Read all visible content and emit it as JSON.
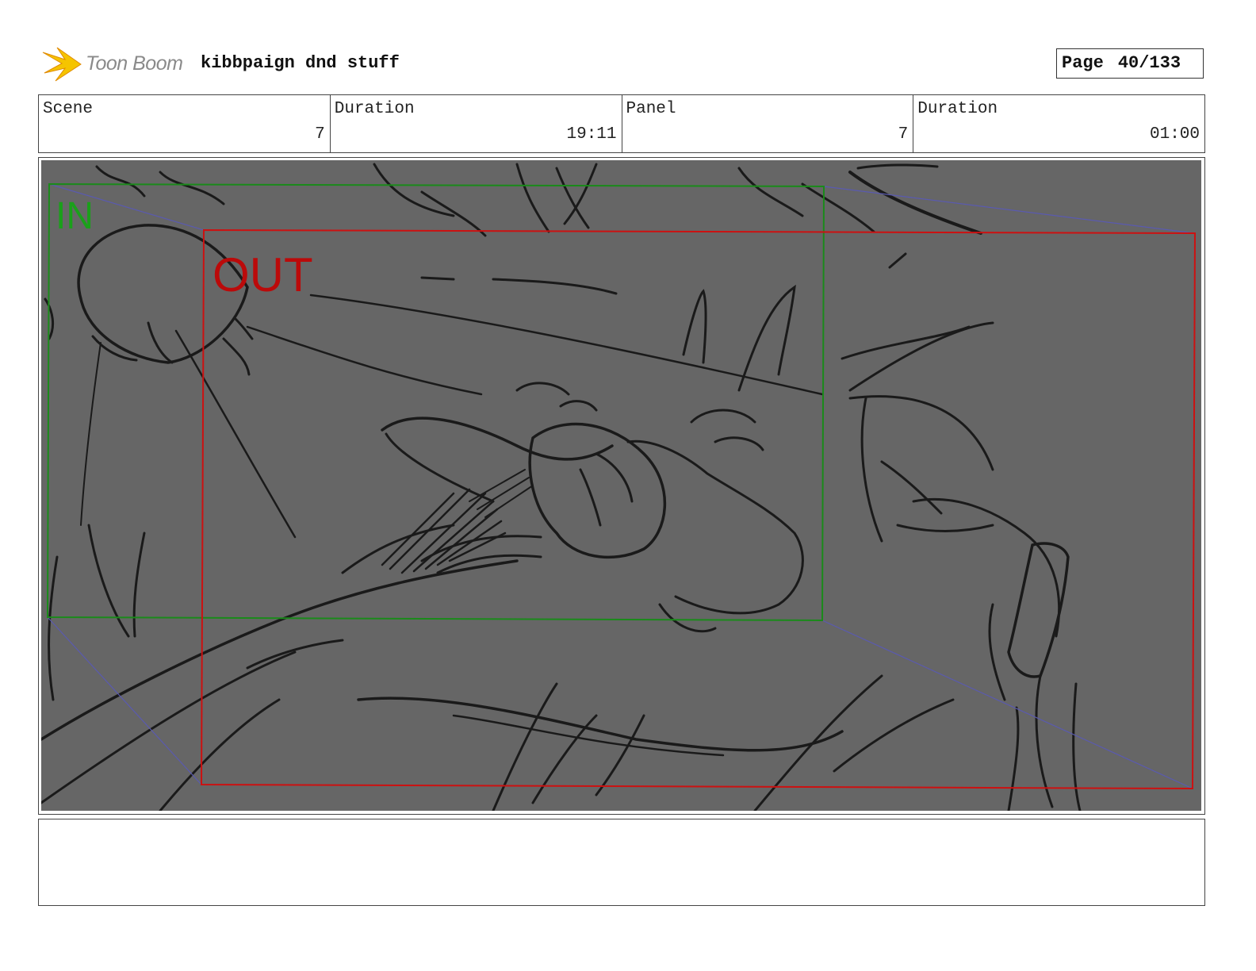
{
  "header": {
    "logo_text": "Toon Boom",
    "logo_icon": "starburst-logo-icon",
    "project_title": "kibbpaign dnd stuff",
    "page_label": "Page",
    "page_value": "40/133"
  },
  "info": {
    "scene_label": "Scene",
    "scene_value": "7",
    "scene_duration_label": "Duration",
    "scene_duration_value": "19:11",
    "panel_label": "Panel",
    "panel_value": "7",
    "panel_duration_label": "Duration",
    "panel_duration_value": "01:00"
  },
  "frame": {
    "in_label": "IN",
    "out_label": "OUT",
    "colors": {
      "background": "#666666",
      "in_frame": "#1a8a1a",
      "out_frame": "#cc1111",
      "motion_path": "#5a5ab0",
      "sketch": "#1a1a1a"
    }
  },
  "notes": {
    "text": ""
  }
}
